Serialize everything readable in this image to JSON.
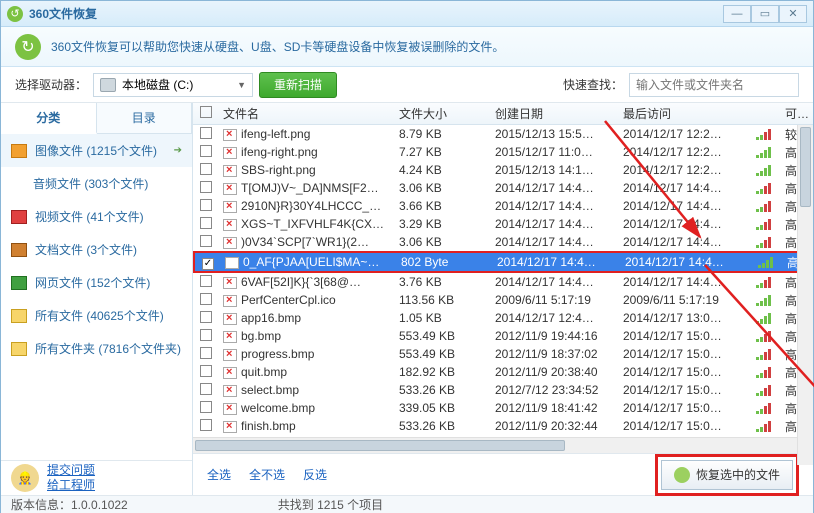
{
  "window": {
    "title": "360文件恢复"
  },
  "info": {
    "text": "360文件恢复可以帮助您快速从硬盘、U盘、SD卡等硬盘设备中恢复被误删除的文件。"
  },
  "toolbar": {
    "drive_label": "选择驱动器：",
    "drive_value": "本地磁盘 (C:)",
    "rescan": "重新扫描",
    "search_label": "快速查找：",
    "search_placeholder": "输入文件或文件夹名"
  },
  "sidebar_tabs": {
    "cat": "分类",
    "dir": "目录"
  },
  "sidebar": [
    {
      "label": "图像文件 (1215个文件)",
      "cls": "img",
      "sel": true
    },
    {
      "label": "音频文件 (303个文件)",
      "cls": "audio"
    },
    {
      "label": "视频文件 (41个文件)",
      "cls": "video"
    },
    {
      "label": "文档文件 (3个文件)",
      "cls": "doc"
    },
    {
      "label": "网页文件 (152个文件)",
      "cls": "web"
    },
    {
      "label": "所有文件 (40625个文件)",
      "cls": "folder"
    },
    {
      "label": "所有文件夹 (7816个文件夹)",
      "cls": "folder"
    }
  ],
  "support": {
    "submit": "提交问题",
    "engineer": "给工程师"
  },
  "columns": {
    "name": "文件名",
    "size": "文件大小",
    "cdate": "创建日期",
    "adate": "最后访问",
    "rec": "可恢复性"
  },
  "rows": [
    {
      "name": "ifeng-left.png",
      "size": "8.79 KB",
      "cdate": "2015/12/13 15:5…",
      "adate": "2014/12/17 12:2…",
      "rec": "较差",
      "bad": true
    },
    {
      "name": "ifeng-right.png",
      "size": "7.27 KB",
      "cdate": "2015/12/17 11:0…",
      "adate": "2014/12/17 12:2…",
      "rec": "高"
    },
    {
      "name": "SBS-right.png",
      "size": "4.24 KB",
      "cdate": "2015/12/13 14:1…",
      "adate": "2014/12/17 12:2…",
      "rec": "高"
    },
    {
      "name": "T[OMJ)V~_DA]NMS[F2…",
      "size": "3.06 KB",
      "cdate": "2014/12/17 14:4…",
      "adate": "2014/12/17 14:4…",
      "rec": "高差",
      "bad": true
    },
    {
      "name": "2910N}R}30Y4LHCCC_…",
      "size": "3.66 KB",
      "cdate": "2014/12/17 14:4…",
      "adate": "2014/12/17 14:4…",
      "rec": "高差",
      "bad": true
    },
    {
      "name": "XGS~T_IXFVHLF4K{CX…",
      "size": "3.29 KB",
      "cdate": "2014/12/17 14:4…",
      "adate": "2014/12/17 14:4…",
      "rec": "高差",
      "bad": true
    },
    {
      "name": ")0V34`SCP[7`WR1}(2…",
      "size": "3.06 KB",
      "cdate": "2014/12/17 14:4…",
      "adate": "2014/12/17 14:4…",
      "rec": "高差",
      "bad": true
    },
    {
      "name": "0_AF{PJAA[UELI$MA~…",
      "size": "802 Byte",
      "cdate": "2014/12/17 14:4…",
      "adate": "2014/12/17 14:4…",
      "rec": "高",
      "sel": true,
      "chk": true
    },
    {
      "name": "6VAF[52I]K}{`3[68@…",
      "size": "3.76 KB",
      "cdate": "2014/12/17 14:4…",
      "adate": "2014/12/17 14:4…",
      "rec": "高差",
      "bad": true
    },
    {
      "name": "PerfCenterCpl.ico",
      "size": "113.56 KB",
      "cdate": "2009/6/11 5:17:19",
      "adate": "2009/6/11 5:17:19",
      "rec": "高"
    },
    {
      "name": "app16.bmp",
      "size": "1.05 KB",
      "cdate": "2014/12/17 12:4…",
      "adate": "2014/12/17 13:0…",
      "rec": "高"
    },
    {
      "name": "bg.bmp",
      "size": "553.49 KB",
      "cdate": "2012/11/9 19:44:16",
      "adate": "2014/12/17 15:0…",
      "rec": "高差",
      "bad": true
    },
    {
      "name": "progress.bmp",
      "size": "553.49 KB",
      "cdate": "2012/11/9 18:37:02",
      "adate": "2014/12/17 15:0…",
      "rec": "高差",
      "bad": true
    },
    {
      "name": "quit.bmp",
      "size": "182.92 KB",
      "cdate": "2012/11/9 20:38:40",
      "adate": "2014/12/17 15:0…",
      "rec": "高差",
      "bad": true
    },
    {
      "name": "select.bmp",
      "size": "533.26 KB",
      "cdate": "2012/7/12 23:34:52",
      "adate": "2014/12/17 15:0…",
      "rec": "高差",
      "bad": true
    },
    {
      "name": "welcome.bmp",
      "size": "339.05 KB",
      "cdate": "2012/11/9 18:41:42",
      "adate": "2014/12/17 15:0…",
      "rec": "高差",
      "bad": true
    },
    {
      "name": "finish.bmp",
      "size": "533.26 KB",
      "cdate": "2012/11/9 20:32:44",
      "adate": "2014/12/17 15:0…",
      "rec": "高差",
      "bad": true
    }
  ],
  "actions": {
    "all": "全选",
    "none": "全不选",
    "invert": "反选",
    "recover": "恢复选中的文件"
  },
  "status": {
    "left": "版本信息：1.0.0.1022",
    "right": "共找到 1215 个项目"
  }
}
